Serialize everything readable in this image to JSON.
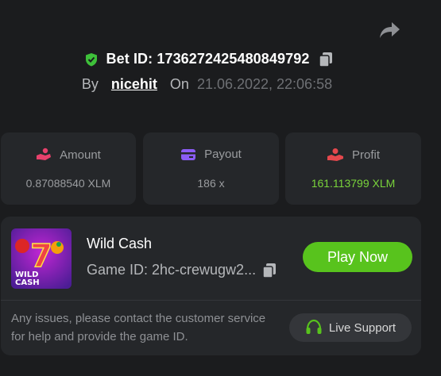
{
  "bet": {
    "id_text": "Bet ID: 1736272425480849792",
    "by_label": "By",
    "user": "nicehit",
    "on_label": "On",
    "date": "21.06.2022, 22:06:58"
  },
  "stats": [
    {
      "label": "Amount",
      "value": "0.87088540 XLM",
      "icon": "coins-hand-icon"
    },
    {
      "label": "Payout",
      "value": "186 x",
      "icon": "card-icon"
    },
    {
      "label": "Profit",
      "value": "161.113799 XLM",
      "icon": "profit-hand-icon"
    }
  ],
  "game": {
    "name": "Wild Cash",
    "game_id": "Game ID: 2hc-crewugw2...",
    "play_label": "Play Now",
    "thumb_title_1": "WILD",
    "thumb_title_2": "CASH",
    "thumb_number": "7"
  },
  "support": {
    "text": "Any issues, please contact the customer service for help and provide the game ID.",
    "button_label": "Live Support"
  },
  "colors": {
    "background": "#1b1c1e",
    "card": "#25272a",
    "accent_green": "#58c31d",
    "profit_green": "#79d33b",
    "amount_icon": "#e8416c",
    "payout_icon": "#8b5cf6",
    "profit_icon": "#e5484d"
  }
}
